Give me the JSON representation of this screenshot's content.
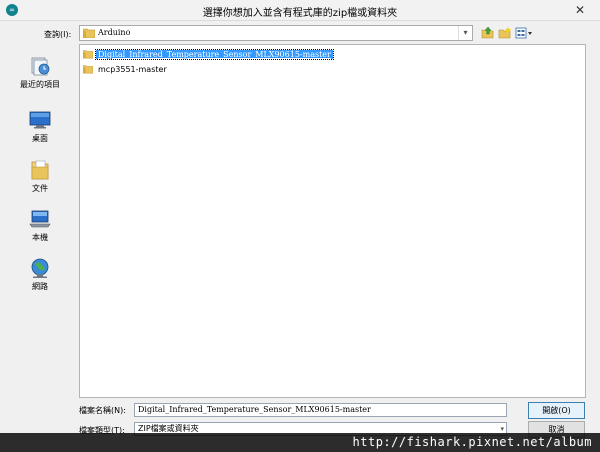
{
  "window": {
    "title": "選擇你想加入並含有程式庫的zip檔或資料夾",
    "icon": "arduino-icon",
    "icon_text": "∞",
    "close_glyph": "✕"
  },
  "lookin": {
    "label": "查詢(I):",
    "value": "Arduino",
    "chevron": "▾"
  },
  "toolbar": {
    "icons": [
      "up-folder-icon",
      "new-folder-icon",
      "view-menu-icon"
    ]
  },
  "places": [
    {
      "label": "最近的項目",
      "icon": "recent-items-icon"
    },
    {
      "label": "桌面",
      "icon": "desktop-icon"
    },
    {
      "label": "文件",
      "icon": "documents-icon"
    },
    {
      "label": "本機",
      "icon": "computer-icon"
    },
    {
      "label": "網路",
      "icon": "network-icon"
    }
  ],
  "files": [
    {
      "name": "Digital_Infrared_Temperature_Sensor_MLX90615-master",
      "selected": true
    },
    {
      "name": "mcp3551-master",
      "selected": false
    }
  ],
  "filename": {
    "label": "檔案名稱(N):",
    "value": "Digital_Infrared_Temperature_Sensor_MLX90615-master"
  },
  "filetype": {
    "label": "檔案類型(T):",
    "value": "ZIP檔案或資料夾",
    "chevron": "▾"
  },
  "buttons": {
    "open": "開啟(O)",
    "cancel": "取消"
  },
  "watermark": {
    "text": "http://fishark.pixnet.net/album"
  },
  "colors": {
    "selection": "#3399ff",
    "folder": "#e8c45a",
    "open_button_border": "#3c7fb1"
  }
}
